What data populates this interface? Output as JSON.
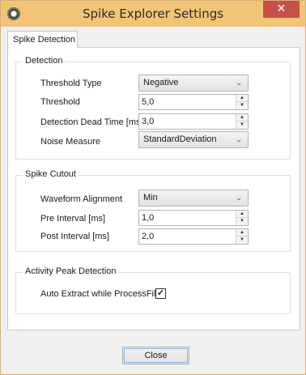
{
  "window": {
    "title": "Spike Explorer Settings",
    "close_glyph": "✕",
    "app_icon": "spike-explorer-app-icon"
  },
  "tabs": [
    {
      "label": "Spike Detection",
      "selected": true
    }
  ],
  "detection": {
    "title": "Detection",
    "threshold_type": {
      "label": "Threshold Type",
      "value": "Negative"
    },
    "threshold": {
      "label": "Threshold",
      "value": "5,0"
    },
    "dead_time": {
      "label": "Detection Dead Time [ms]",
      "value": "3,0"
    },
    "noise_measure": {
      "label": "Noise Measure",
      "value": "StandardDeviation"
    }
  },
  "cutout": {
    "title": "Spike Cutout",
    "waveform_alignment": {
      "label": "Waveform Alignment",
      "value": "Min"
    },
    "pre_interval": {
      "label": "Pre Interval [ms]",
      "value": "1,0"
    },
    "post_interval": {
      "label": "Post Interval [ms]",
      "value": "2,0"
    }
  },
  "activity": {
    "title": "Activity Peak Detection",
    "auto_extract": {
      "label": "Auto Extract while ProcessFile",
      "checked": true,
      "check_glyph": "✓"
    }
  },
  "footer": {
    "close_label": "Close"
  },
  "icons": {
    "chevron": "⌄",
    "up": "▲",
    "down": "▼"
  },
  "colors": {
    "titlebar": "#f2c477",
    "close_button": "#c7504b"
  }
}
